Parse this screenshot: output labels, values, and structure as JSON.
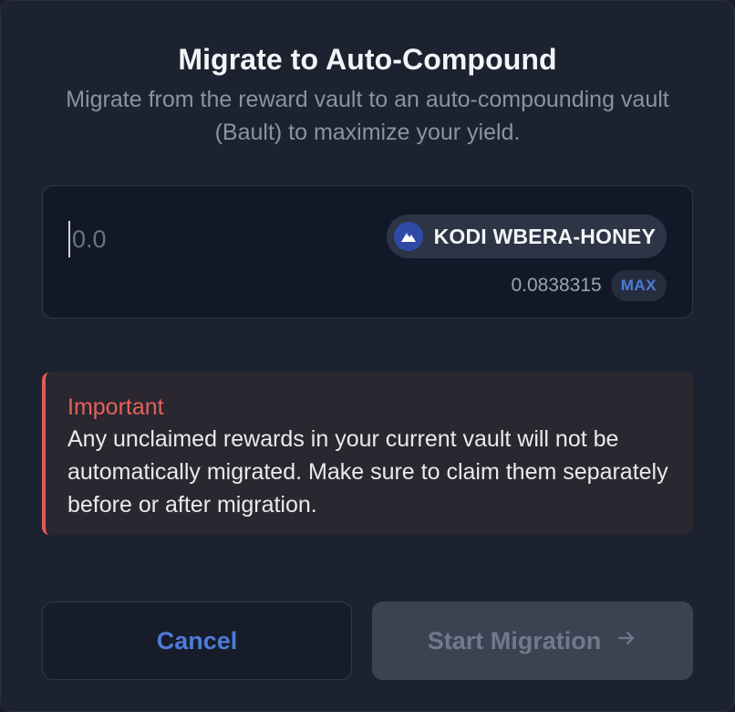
{
  "dialog": {
    "title": "Migrate to Auto-Compound",
    "subtitle": "Migrate from the reward vault to an auto-compounding vault (Bault) to maximize your yield."
  },
  "amount": {
    "placeholder": "0.0",
    "value": ""
  },
  "token": {
    "label": "KODI WBERA-HONEY",
    "icon": "kodiak-mountain-icon"
  },
  "balance": {
    "value": "0.0838315",
    "max_label": "MAX"
  },
  "alert": {
    "title": "Important",
    "body": "Any unclaimed rewards in your current vault will not be automatically migrated. Make sure to claim them separately before or after migration."
  },
  "actions": {
    "cancel_label": "Cancel",
    "start_label": "Start Migration",
    "start_icon": "arrow-right-icon"
  },
  "colors": {
    "accent": "#4d7bd9",
    "danger": "#e05a55",
    "background": "#1c2230"
  }
}
